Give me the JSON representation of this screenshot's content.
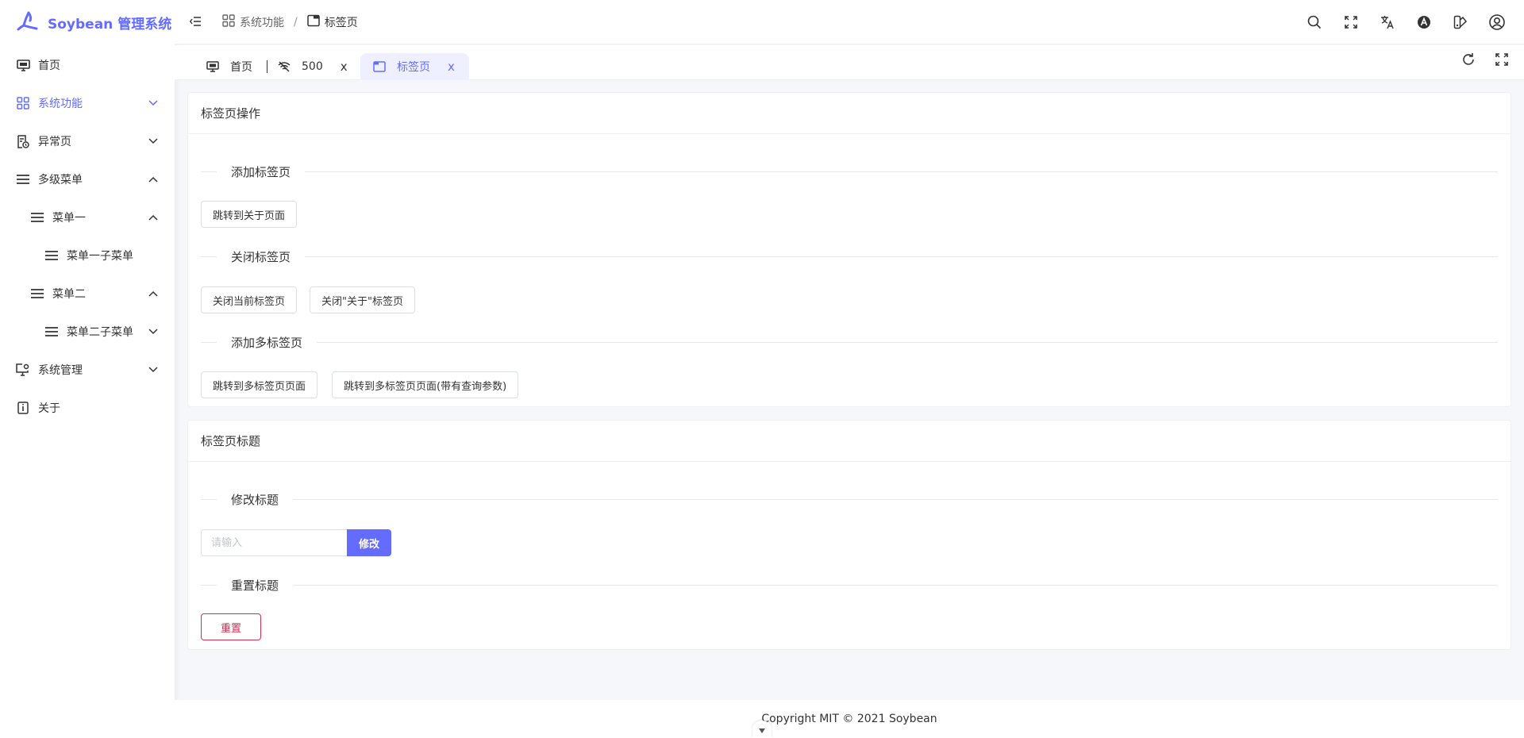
{
  "app": {
    "title": "Soybean 管理系统"
  },
  "sidebar": {
    "items": [
      {
        "label": "首页"
      },
      {
        "label": "系统功能"
      },
      {
        "label": "异常页"
      },
      {
        "label": "多级菜单"
      },
      {
        "label": "菜单一"
      },
      {
        "label": "菜单一子菜单"
      },
      {
        "label": "菜单二"
      },
      {
        "label": "菜单二子菜单"
      },
      {
        "label": "系统管理"
      },
      {
        "label": "关于"
      }
    ]
  },
  "breadcrumb": {
    "parent": "系统功能",
    "current": "标签页"
  },
  "tabs": [
    {
      "label": "首页"
    },
    {
      "label": "500",
      "close": "x"
    },
    {
      "label": "标签页",
      "close": "x"
    }
  ],
  "card_ops": {
    "title": "标签页操作",
    "add_section": "添加标签页",
    "goto_about": "跳转到关于页面",
    "close_section": "关闭标签页",
    "close_current": "关闭当前标签页",
    "close_about": "关闭\"关于\"标签页",
    "multi_section": "添加多标签页",
    "goto_multi": "跳转到多标签页页面",
    "goto_multi_query": "跳转到多标签页页面(带有查询参数)"
  },
  "card_title": {
    "title": "标签页标题",
    "modify_section": "修改标题",
    "input_placeholder": "请输入",
    "modify_button": "修改",
    "reset_section": "重置标题",
    "reset_button": "重置"
  },
  "footer": {
    "text": "Copyright MIT © 2021 Soybean"
  },
  "colors": {
    "primary": "#646cff",
    "danger": "#d03050"
  }
}
